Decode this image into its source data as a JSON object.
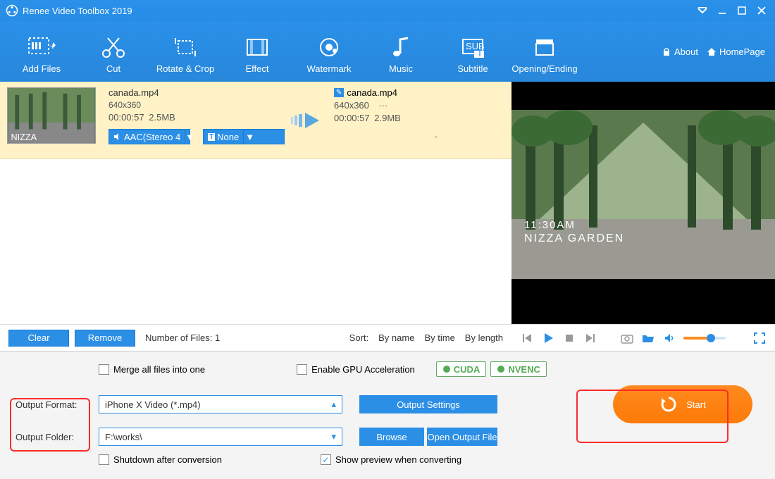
{
  "app": {
    "title": "Renee Video Toolbox 2019"
  },
  "menu": {
    "items": [
      "Add Files",
      "Cut",
      "Rotate & Crop",
      "Effect",
      "Watermark",
      "Music",
      "Subtitle",
      "Opening/Ending"
    ],
    "about": "About",
    "homepage": "HomePage"
  },
  "file": {
    "name": "canada.mp4",
    "res": "640x360",
    "dur": "00:00:57",
    "size": "2.5MB",
    "audio": "AAC(Stereo 4",
    "subtitle": "None",
    "out_name": "canada.mp4",
    "out_res": "640x360",
    "out_extra": "···",
    "out_dur": "00:00:57",
    "out_size": "2.9MB"
  },
  "preview": {
    "time": "11:30AM",
    "place": "NIZZA GARDEN"
  },
  "list": {
    "clear": "Clear",
    "remove": "Remove",
    "count_label": "Number of Files:  1",
    "sort_label": "Sort:",
    "by_name": "By name",
    "by_time": "By time",
    "by_length": "By length"
  },
  "opts": {
    "merge": "Merge all files into one",
    "gpu": "Enable GPU Acceleration",
    "cuda": "CUDA",
    "nvenc": "NVENC",
    "format_label": "Output Format:",
    "format_value": "iPhone X Video (*.mp4)",
    "folder_label": "Output Folder:",
    "folder_value": "F:\\works\\",
    "settings": "Output Settings",
    "browse": "Browse",
    "open": "Open Output File",
    "shutdown": "Shutdown after conversion",
    "show_preview": "Show preview when converting",
    "start": "Start"
  }
}
